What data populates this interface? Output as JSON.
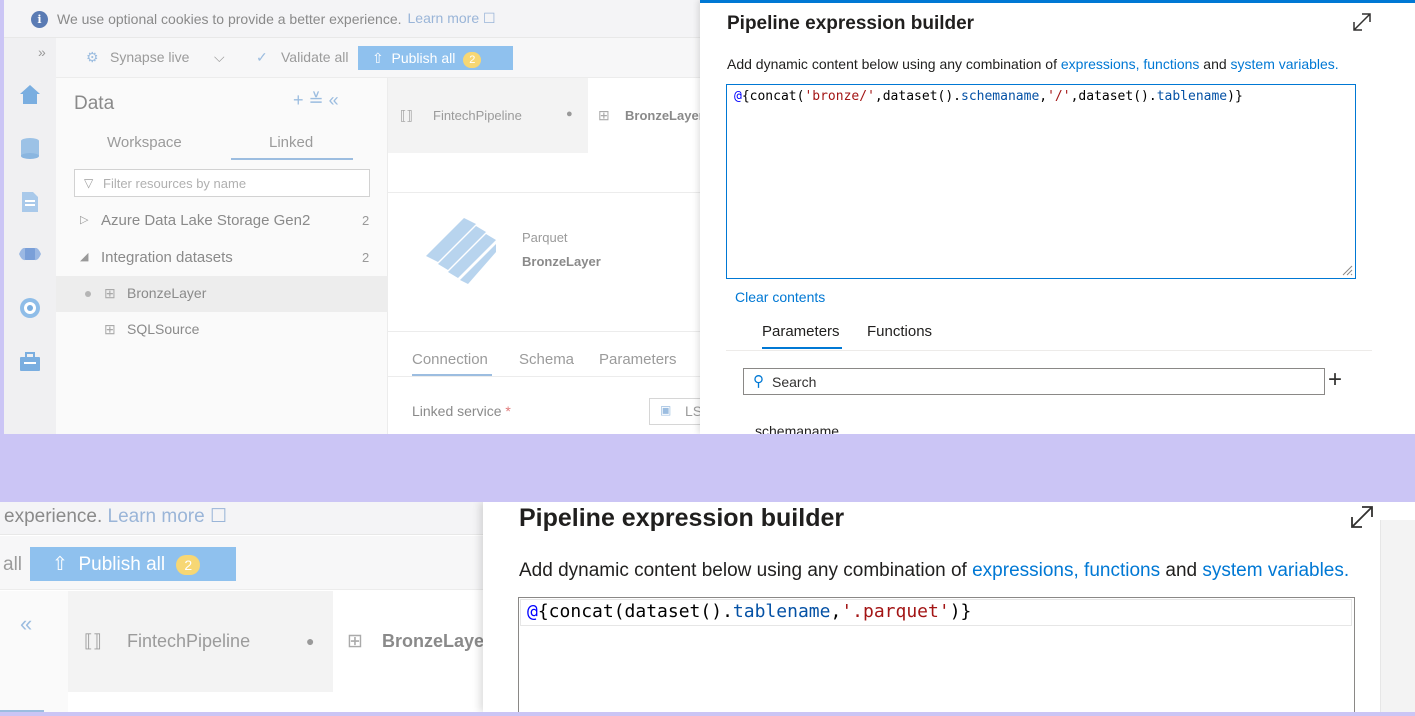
{
  "top": {
    "cookie_bar": {
      "text": "We use optional cookies to provide a better experience.",
      "link": "Learn more ☐"
    },
    "toolbar": {
      "synapse_live": "Synapse live",
      "chevron": "⌵",
      "validate_all": "Validate all",
      "publish_all": "Publish all",
      "publish_count": "2",
      "expand": "»"
    },
    "data_panel": {
      "title": "Data",
      "tools": "+ ≚ «",
      "tabs": [
        "Workspace",
        "Linked"
      ],
      "filter_placeholder": "Filter resources by name",
      "groups": [
        {
          "label": "Azure Data Lake Storage Gen2",
          "count": "2",
          "arrow": "▷"
        },
        {
          "label": "Integration datasets",
          "count": "2",
          "arrow": "◢"
        }
      ],
      "datasets": [
        "BronzeLayer",
        "SQLSource"
      ]
    },
    "editor": {
      "tab_pipeline": "FintechPipeline",
      "tab_dataset": "BronzeLayer",
      "format_label": "Parquet",
      "dataset_name": "BronzeLayer",
      "tabs": [
        "Connection",
        "Schema",
        "Parameters"
      ],
      "linked_service_label": "Linked service",
      "required_mark": "*",
      "linked_service_value": "LS"
    },
    "builder": {
      "title": "Pipeline expression builder",
      "desc_prefix": "Add dynamic content below using any combination of",
      "desc_link1": "expressions, functions",
      "desc_and": "and",
      "desc_link2": "system variables.",
      "code": {
        "at": "@",
        "p1": "{concat(",
        "s1": "'bronze/'",
        "p2": ",dataset().",
        "k1": "schemaname",
        "p3": ",",
        "s2": "'/'",
        "p4": ",dataset().",
        "k2": "tablename",
        "p5": ")}"
      },
      "clear_contents": "Clear contents",
      "tabs": [
        "Parameters",
        "Functions"
      ],
      "search_placeholder": "Search",
      "add": "+",
      "params": [
        "schemaname"
      ]
    }
  },
  "bottom": {
    "cookie_text": "experience.",
    "cookie_link": "Learn more ☐",
    "all_text": "all",
    "publish_all": "Publish all",
    "publish_count": "2",
    "collapse": "«",
    "tab_pipeline": "FintechPipeline",
    "tab_dataset": "BronzeLayer",
    "builder": {
      "title": "Pipeline expression builder",
      "desc_prefix": "Add dynamic content below using any combination of",
      "desc_link1": "expressions, functions",
      "desc_and": "and",
      "desc_link2": "system variables.",
      "code": {
        "at": "@",
        "p1": "{concat(dataset().",
        "k1": "tablename",
        "p2": ",",
        "s1": "'.parquet'",
        "p3": ")}"
      }
    }
  }
}
